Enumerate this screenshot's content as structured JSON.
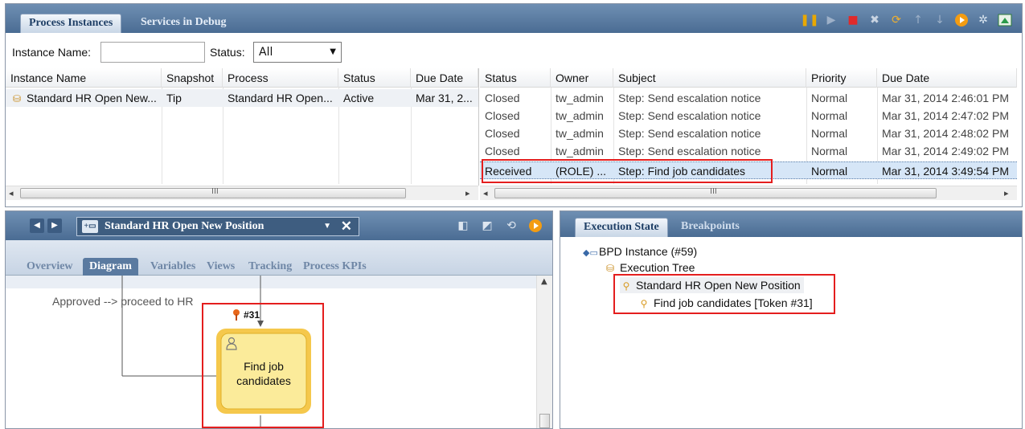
{
  "top_tabs": {
    "process_instances": "Process Instances",
    "services_in_debug": "Services in Debug"
  },
  "toolbar_icons": [
    "pause-icon",
    "step-icon",
    "stop-icon",
    "delete-icon",
    "refresh-icon",
    "move-up-icon",
    "move-down-icon",
    "run-icon",
    "debug-icon",
    "inspector-icon"
  ],
  "filters": {
    "instance_name_label": "Instance Name:",
    "instance_name_value": "",
    "status_label": "Status:",
    "status_value": "All"
  },
  "instances_table": {
    "columns": [
      "Instance Name",
      "Snapshot",
      "Process",
      "Status",
      "Due Date"
    ],
    "rows": [
      [
        "Standard HR Open New...",
        "Tip",
        "Standard HR Open...",
        "Active",
        "Mar 31, 2..."
      ]
    ]
  },
  "tasks_table": {
    "columns": [
      "Status",
      "Owner",
      "Subject",
      "Priority",
      "Due Date"
    ],
    "rows": [
      [
        "Closed",
        "tw_admin",
        "Step: Send escalation notice",
        "Normal",
        "Mar 31, 2014 2:46:01 PM"
      ],
      [
        "Closed",
        "tw_admin",
        "Step: Send escalation notice",
        "Normal",
        "Mar 31, 2014 2:47:02 PM"
      ],
      [
        "Closed",
        "tw_admin",
        "Step: Send escalation notice",
        "Normal",
        "Mar 31, 2014 2:48:02 PM"
      ],
      [
        "Closed",
        "tw_admin",
        "Step: Send escalation notice",
        "Normal",
        "Mar 31, 2014 2:49:02 PM"
      ],
      [
        "Received",
        "(ROLE) ...",
        "Step: Find job candidates",
        "Normal",
        "Mar 31, 2014 3:49:54 PM"
      ]
    ],
    "selected_row": 4
  },
  "scroll_glyph": "III",
  "process_editor": {
    "title": "Standard HR Open New Position",
    "tabs": [
      "Overview",
      "Diagram",
      "Variables",
      "Views",
      "Tracking",
      "Process KPIs"
    ],
    "active_tab": "Diagram",
    "flow_label": "Approved --> proceed to HR",
    "token_label": "#31",
    "activity_label_line1": "Find job",
    "activity_label_line2": "candidates"
  },
  "execution_panel": {
    "tabs": [
      "Execution State",
      "Breakpoints"
    ],
    "active_tab": "Execution State",
    "tree": {
      "root": "BPD Instance (#59)",
      "execution_tree": "Execution Tree",
      "process": "Standard HR Open New Position",
      "token": "Find job candidates [Token #31]"
    }
  },
  "colors": {
    "header_blue": "#4a6c93",
    "highlight_red": "#e41e1e",
    "activity_yellow": "#f7e27a",
    "selection_blue": "#d6e6f7"
  }
}
